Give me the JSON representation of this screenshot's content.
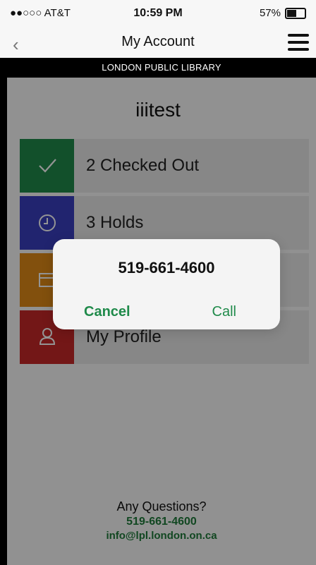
{
  "status_bar": {
    "carrier": "●●○○○ AT&T",
    "time": "10:59 PM",
    "battery": "57%"
  },
  "nav": {
    "title": "My Account",
    "back_icon": "chevron-left-icon",
    "menu_icon": "hamburger-menu-icon"
  },
  "banner": "LONDON PUBLIC LIBRARY",
  "username": "iiitest",
  "items": [
    {
      "label": "2 Checked Out",
      "color": "#1f8a4a",
      "icon": "checkmark-icon"
    },
    {
      "label": "3 Holds",
      "color": "#3a3fbf",
      "icon": "clock-icon"
    },
    {
      "label": "",
      "color": "#e08a17",
      "icon": "box-icon"
    },
    {
      "label": "My Profile",
      "color": "#c62828",
      "icon": "person-icon"
    }
  ],
  "footer": {
    "question": "Any Questions?",
    "phone": "519-661-4600",
    "email": "info@lpl.london.on.ca"
  },
  "alert": {
    "title": "519-661-4600",
    "cancel": "Cancel",
    "call": "Call"
  },
  "colors": {
    "accent_green": "#1f8a4a",
    "overlay": "rgba(0,0,0,0.42)"
  }
}
